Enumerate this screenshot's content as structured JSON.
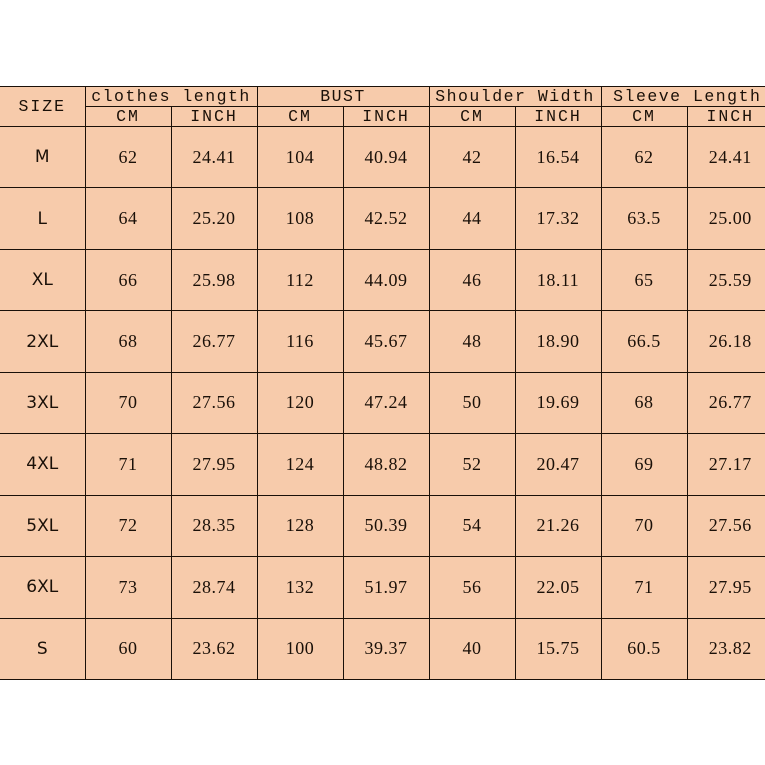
{
  "table": {
    "size_header": "SIZE",
    "groups": [
      {
        "label": "clothes length"
      },
      {
        "label": "BUST"
      },
      {
        "label": "Shoulder Width"
      },
      {
        "label": "Sleeve Length"
      }
    ],
    "units": [
      "CM",
      "INCH",
      "CM",
      "INCH",
      "CM",
      "INCH",
      "CM",
      "INCH"
    ],
    "rows": [
      {
        "size": "M",
        "values": [
          "62",
          "24.41",
          "104",
          "40.94",
          "42",
          "16.54",
          "62",
          "24.41"
        ]
      },
      {
        "size": "L",
        "values": [
          "64",
          "25.20",
          "108",
          "42.52",
          "44",
          "17.32",
          "63.5",
          "25.00"
        ]
      },
      {
        "size": "XL",
        "values": [
          "66",
          "25.98",
          "112",
          "44.09",
          "46",
          "18.11",
          "65",
          "25.59"
        ]
      },
      {
        "size": "2XL",
        "values": [
          "68",
          "26.77",
          "116",
          "45.67",
          "48",
          "18.90",
          "66.5",
          "26.18"
        ]
      },
      {
        "size": "3XL",
        "values": [
          "70",
          "27.56",
          "120",
          "47.24",
          "50",
          "19.69",
          "68",
          "26.77"
        ]
      },
      {
        "size": "4XL",
        "values": [
          "71",
          "27.95",
          "124",
          "48.82",
          "52",
          "20.47",
          "69",
          "27.17"
        ]
      },
      {
        "size": "5XL",
        "values": [
          "72",
          "28.35",
          "128",
          "50.39",
          "54",
          "21.26",
          "70",
          "27.56"
        ]
      },
      {
        "size": "6XL",
        "values": [
          "73",
          "28.74",
          "132",
          "51.97",
          "56",
          "22.05",
          "71",
          "27.95"
        ]
      },
      {
        "size": "S",
        "values": [
          "60",
          "23.62",
          "100",
          "39.37",
          "40",
          "15.75",
          "60.5",
          "23.82"
        ]
      }
    ]
  },
  "colors": {
    "table_background": "#f7cbab",
    "border": "#1a1008",
    "text": "#1a1008",
    "page_background": "#ffffff"
  }
}
